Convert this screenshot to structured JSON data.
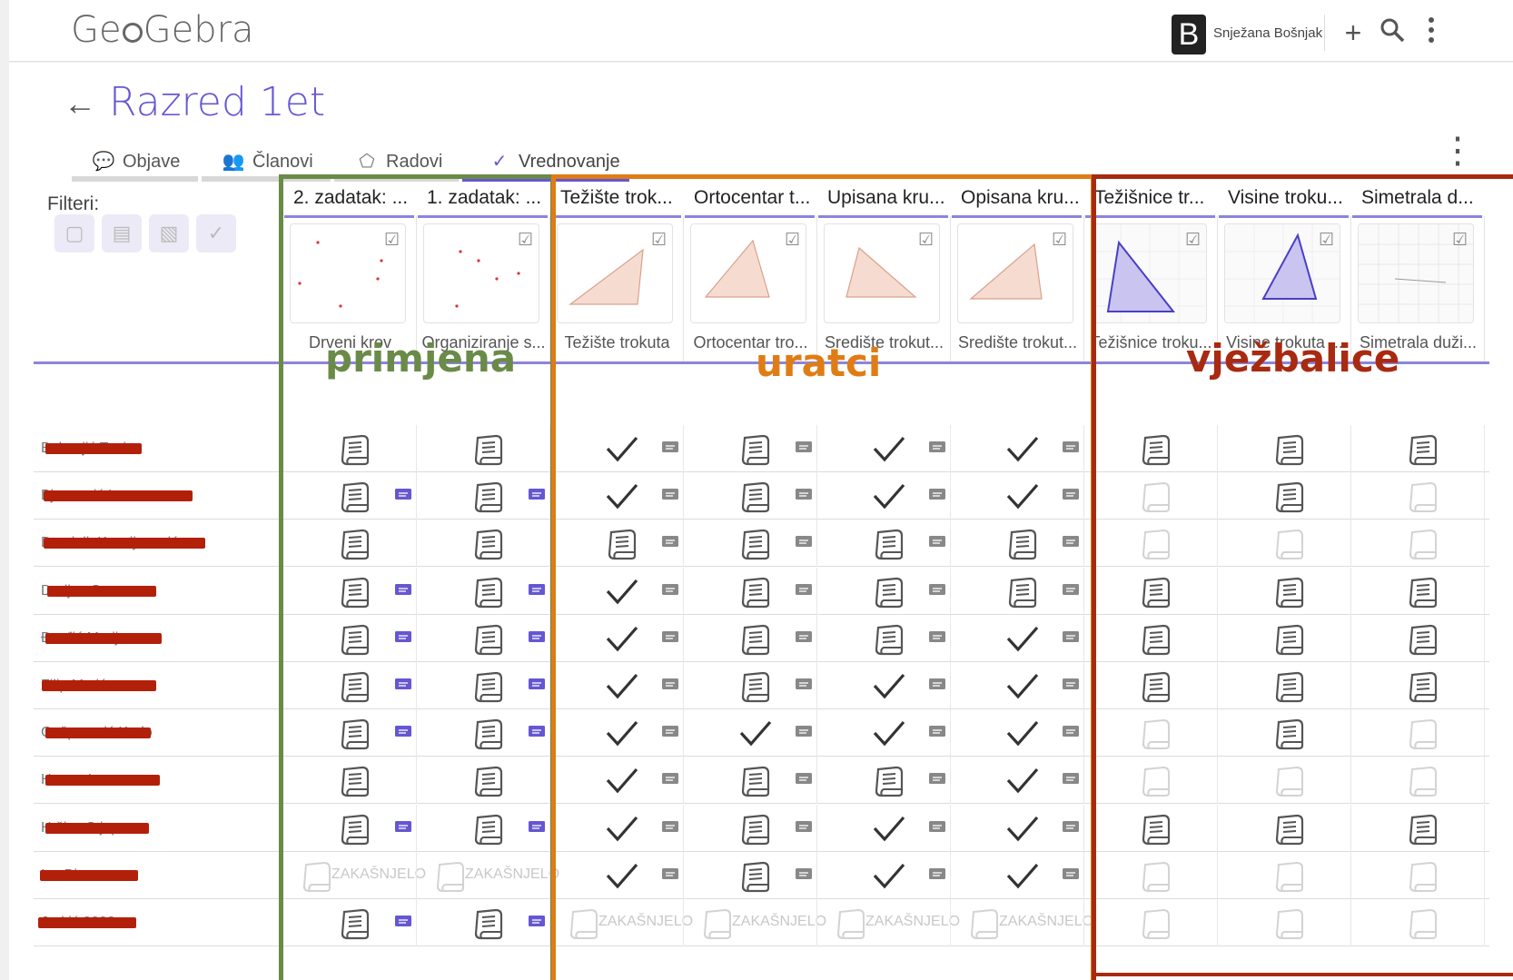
{
  "header": {
    "logo": "Ge✿Gebra",
    "logo_left": "Ge",
    "logo_right": "Gebra",
    "avatar_letter": "B",
    "user_name": "Snježana Bošnjak",
    "plus_icon": "plus-icon",
    "search_icon": "search-icon",
    "more_icon": "more-vert-icon"
  },
  "page": {
    "back_icon": "arrow-left-icon",
    "title": "Razred 1et",
    "tabs": [
      {
        "label": "Objave",
        "icon": "chat-icon",
        "active": false
      },
      {
        "label": "Članovi",
        "icon": "people-icon",
        "active": false
      },
      {
        "label": "Radovi",
        "icon": "pentagon-icon",
        "active": false
      },
      {
        "label": "Vrednovanje",
        "icon": "check-icon",
        "active": true
      }
    ],
    "filters_label": "Filteri:"
  },
  "colors": {
    "accent": "#6557d2",
    "group_primjena": "#6a8b48",
    "group_uratci": "#e07c14",
    "group_vjezbalice": "#a82a10",
    "redaction": "#b3200a"
  },
  "groups": [
    {
      "label": "primjena",
      "color": "#6a8b48"
    },
    {
      "label": "uratci",
      "color": "#e07c14"
    },
    {
      "label": "vježbalice",
      "color": "#a82a10"
    }
  ],
  "columns": [
    {
      "header": "2. zadatak: ...",
      "title": "Drveni krov"
    },
    {
      "header": "1. zadatak: ...",
      "title": "Organiziranje s..."
    },
    {
      "header": "Težište trok...",
      "title": "Težište trokuta"
    },
    {
      "header": "Ortocentar t...",
      "title": "Ortocentar tro..."
    },
    {
      "header": "Upisana kru...",
      "title": "Središte trokut..."
    },
    {
      "header": "Opisana kru...",
      "title": "Središte trokut..."
    },
    {
      "header": "Težišnice tr...",
      "title": "Težišnice troku..."
    },
    {
      "header": "Visine troku...",
      "title": "Visine trokuta ..."
    },
    {
      "header": "Simetrala d...",
      "title": "Simetrala duži..."
    }
  ],
  "late_label": "ZAKAŠNJELO",
  "rows": [
    {
      "name": "Bukonjić Toni",
      "cells": [
        "T",
        "T",
        "C",
        "T",
        "C",
        "C",
        "T",
        "T",
        "T"
      ],
      "msg": [
        0,
        0,
        1,
        1,
        1,
        1,
        0,
        0,
        0
      ]
    },
    {
      "name": "Bjeanović Ines",
      "cells": [
        "T",
        "T",
        "C",
        "T",
        "C",
        "C",
        "E",
        "T",
        "E"
      ],
      "msg": [
        1,
        1,
        1,
        1,
        1,
        1,
        0,
        0,
        0
      ]
    },
    {
      "name": "Dominik Koscljanović",
      "cells": [
        "T",
        "T",
        "T",
        "T",
        "T",
        "T",
        "E",
        "E",
        "E"
      ],
      "msg": [
        0,
        0,
        1,
        1,
        1,
        1,
        0,
        0,
        0
      ]
    },
    {
      "name": "Dorijan Sever",
      "cells": [
        "T",
        "T",
        "C",
        "T",
        "T",
        "T",
        "T",
        "T",
        "T"
      ],
      "msg": [
        1,
        1,
        1,
        1,
        1,
        1,
        0,
        0,
        0
      ]
    },
    {
      "name": "Đurđić Marijo",
      "cells": [
        "T",
        "T",
        "C",
        "T",
        "T",
        "C",
        "T",
        "T",
        "T"
      ],
      "msg": [
        1,
        1,
        1,
        1,
        1,
        1,
        0,
        0,
        0
      ]
    },
    {
      "name": "Filip Matić",
      "cells": [
        "T",
        "T",
        "C",
        "T",
        "C",
        "C",
        "T",
        "T",
        "T"
      ],
      "msg": [
        1,
        1,
        1,
        1,
        1,
        1,
        0,
        0,
        0
      ]
    },
    {
      "name": "Gašparović Karlo",
      "cells": [
        "T",
        "T",
        "C",
        "C",
        "C",
        "C",
        "E",
        "T",
        "E"
      ],
      "msg": [
        1,
        1,
        1,
        1,
        1,
        1,
        0,
        0,
        0
      ]
    },
    {
      "name": "Horvat Ivan",
      "cells": [
        "T",
        "T",
        "C",
        "T",
        "T",
        "C",
        "E",
        "E",
        "E"
      ],
      "msg": [
        0,
        0,
        1,
        1,
        1,
        1,
        0,
        0,
        0
      ]
    },
    {
      "name": "Hržica Stjepan",
      "cells": [
        "T",
        "T",
        "C",
        "T",
        "C",
        "C",
        "T",
        "T",
        "T"
      ],
      "msg": [
        1,
        1,
        1,
        1,
        1,
        1,
        0,
        0,
        0
      ]
    },
    {
      "name": "Ivo Bir",
      "cells": [
        "L",
        "L",
        "C",
        "T",
        "C",
        "C",
        "E",
        "E",
        "E"
      ],
      "msg": [
        0,
        0,
        1,
        1,
        1,
        1,
        0,
        0,
        0
      ]
    },
    {
      "name": "Jurkić 2222",
      "cells": [
        "T",
        "T",
        "L",
        "L",
        "L",
        "L",
        "E",
        "E",
        "E"
      ],
      "msg": [
        1,
        1,
        0,
        0,
        0,
        0,
        0,
        0,
        0
      ]
    }
  ]
}
